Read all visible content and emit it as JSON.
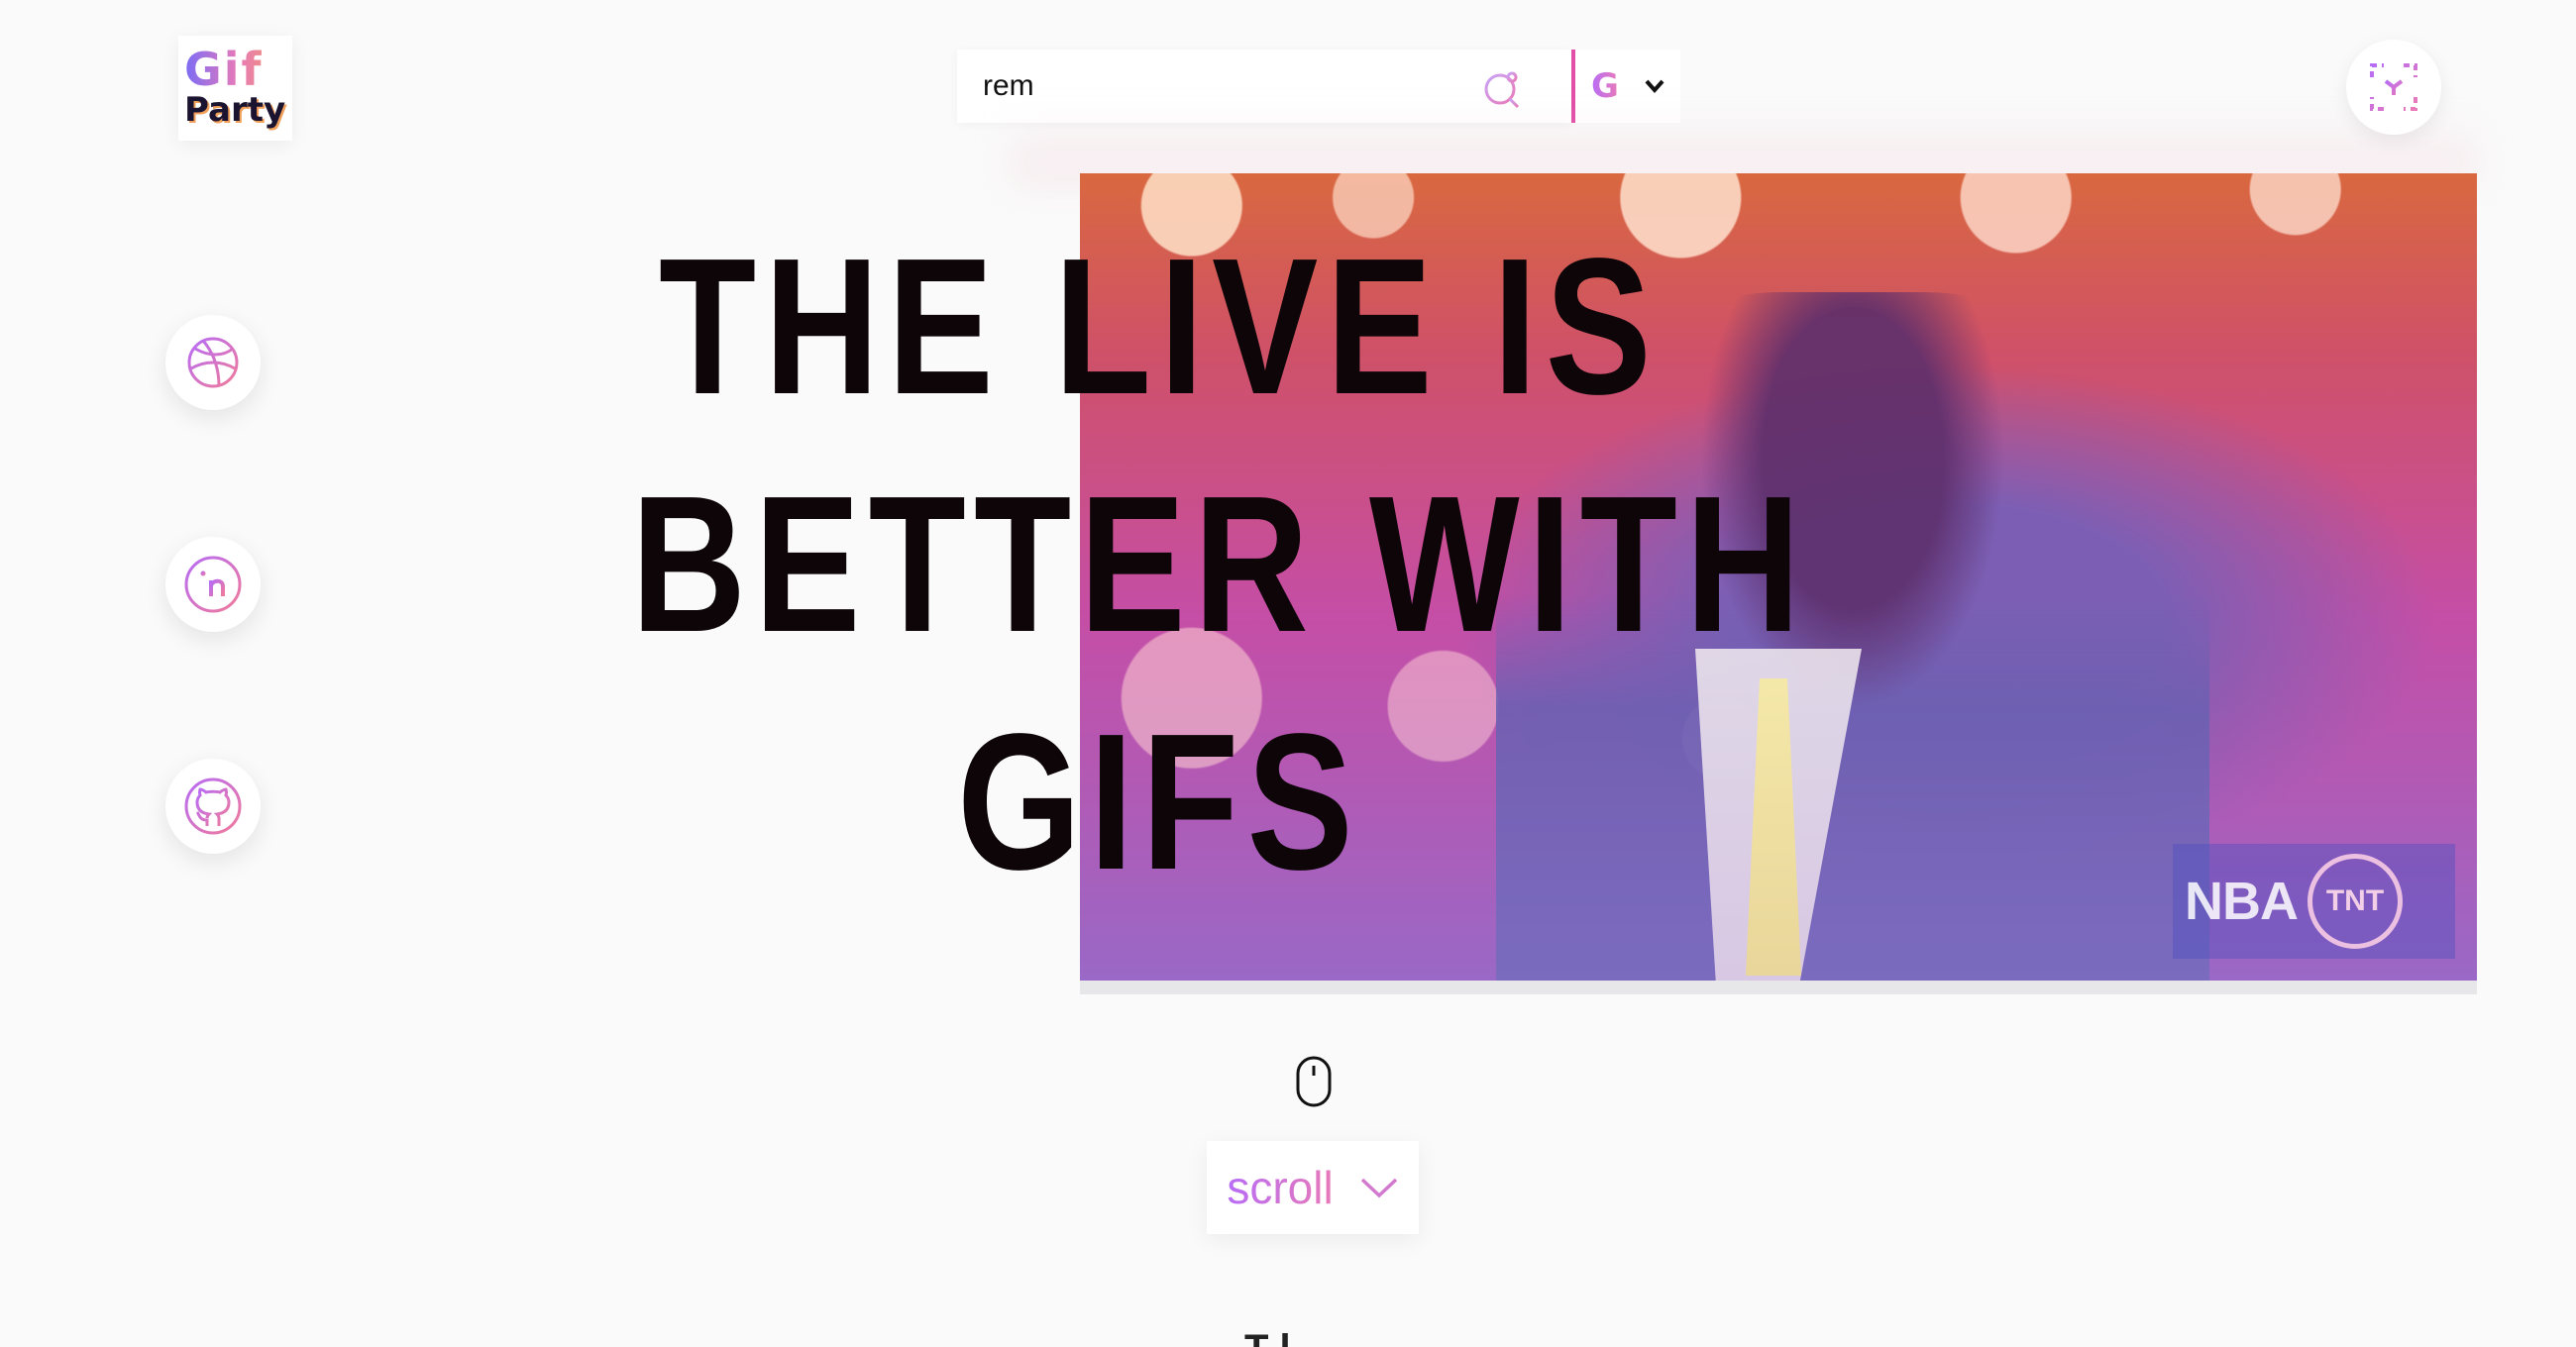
{
  "logo": {
    "line1": "Gif",
    "line2": "Party"
  },
  "search": {
    "value": "rem",
    "placeholder": ""
  },
  "provider": {
    "selected": "G"
  },
  "hero": {
    "line1": "THE LIVE IS",
    "line2": "BETTER WITH",
    "line3": "GIFS",
    "watermark_left": "NBA",
    "watermark_right": "TNT"
  },
  "scroll": {
    "label": "scroll"
  },
  "below": {
    "partial_text": "T  l"
  },
  "colors": {
    "accent_pink": "#e24fa7",
    "accent_purple": "#b76cf6",
    "headline": "#0d0508"
  },
  "icons": {
    "search": "search-icon",
    "corner": "fullscreen-icon",
    "social": [
      "dribbble-icon",
      "linkedin-icon",
      "github-icon"
    ],
    "mouse": "mouse-icon",
    "chevron": "chevron-down-icon"
  }
}
